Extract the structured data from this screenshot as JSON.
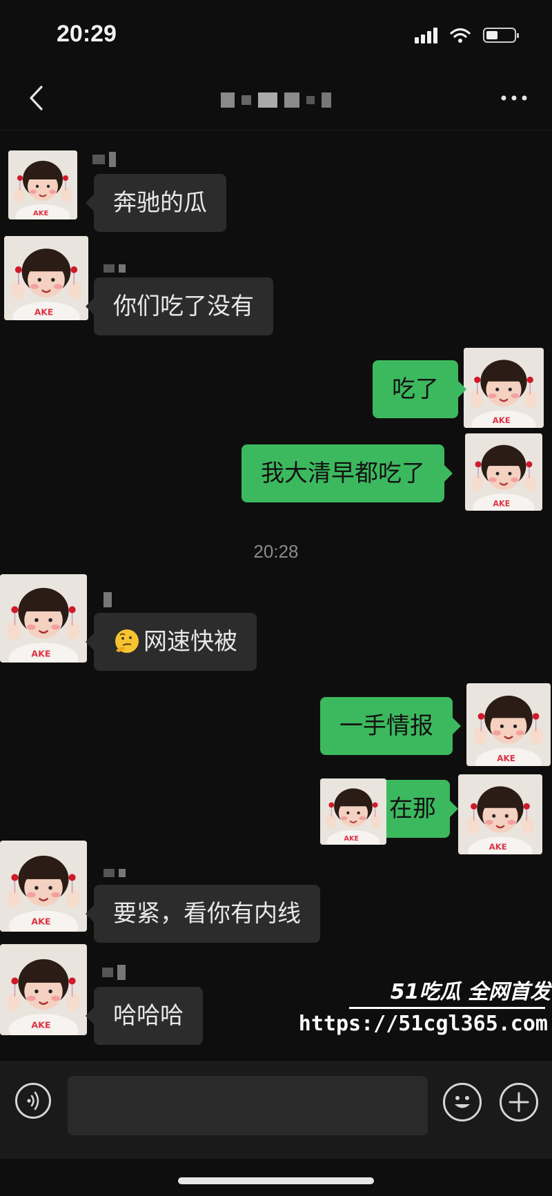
{
  "status_bar": {
    "time": "20:29"
  },
  "messages": [
    {
      "side": "in",
      "text": "奔驰的瓜"
    },
    {
      "side": "in",
      "text": "你们吃了没有"
    },
    {
      "side": "out",
      "text": "吃了"
    },
    {
      "side": "out",
      "text": "我大清早都吃了"
    },
    {
      "type": "timestamp",
      "text": "20:28"
    },
    {
      "side": "in",
      "text": "网速快被",
      "emoji": "thinking-face-emoji"
    },
    {
      "side": "out",
      "text": "一手情报"
    },
    {
      "side": "out",
      "text": "在那"
    },
    {
      "side": "in",
      "text": "要紧，看你有内线"
    },
    {
      "side": "in",
      "text": "哈哈哈"
    }
  ],
  "watermark": {
    "brand": "51吃瓜 全网首发",
    "url": "https://51cgl365.com"
  },
  "input": {
    "placeholder": ""
  },
  "icons": {
    "back": "chevron-left-icon",
    "more": "more-dots-icon",
    "voice": "voice-icon",
    "emoji": "smiley-icon",
    "plus": "plus-icon"
  },
  "colors": {
    "background": "#0e0e0e",
    "bubble_in": "#2c2c2c",
    "bubble_out": "#3cb95e"
  }
}
